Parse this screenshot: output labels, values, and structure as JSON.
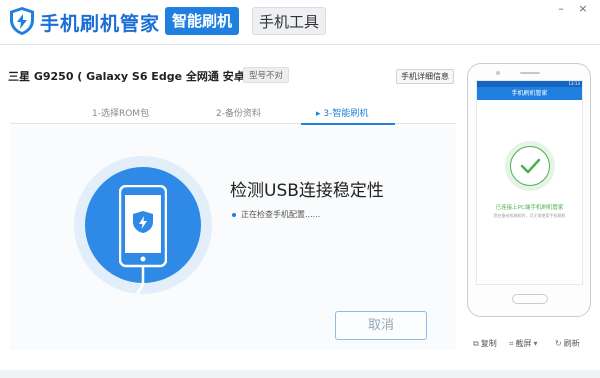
{
  "header": {
    "app_title": "手机刷机管家",
    "tabs": [
      {
        "label": "智能刷机",
        "active": true
      },
      {
        "label": "手机工具",
        "active": false
      }
    ],
    "window_controls": {
      "minimize": "–",
      "close": "×"
    }
  },
  "device": {
    "name": "三星  G9250 ( Galaxy S6 Edge 全网通 安卓6.0 )",
    "model_badge": "型号不对",
    "detail_button": "手机详细信息"
  },
  "steps": [
    {
      "label": "1-选择ROM包",
      "active": false
    },
    {
      "label": "2-备份资料",
      "active": false
    },
    {
      "label": "▸ 3-智能刷机",
      "active": true
    }
  ],
  "main": {
    "heading": "检测USB连接稳定性",
    "status": "正在检查手机配置......",
    "cancel_button": "取消"
  },
  "preview": {
    "status_time": "13:13",
    "app_title": "手机刷机管家",
    "connected_text": "已连接上PC端手机刷机管家",
    "hint_text": "您在备份机刷机时，可正常使用手机刷机"
  },
  "preview_toolbar": {
    "copy": "复制",
    "screenshot": "截屏",
    "refresh": "刷新"
  },
  "colors": {
    "accent": "#1f80e0",
    "success": "#4caf50"
  }
}
